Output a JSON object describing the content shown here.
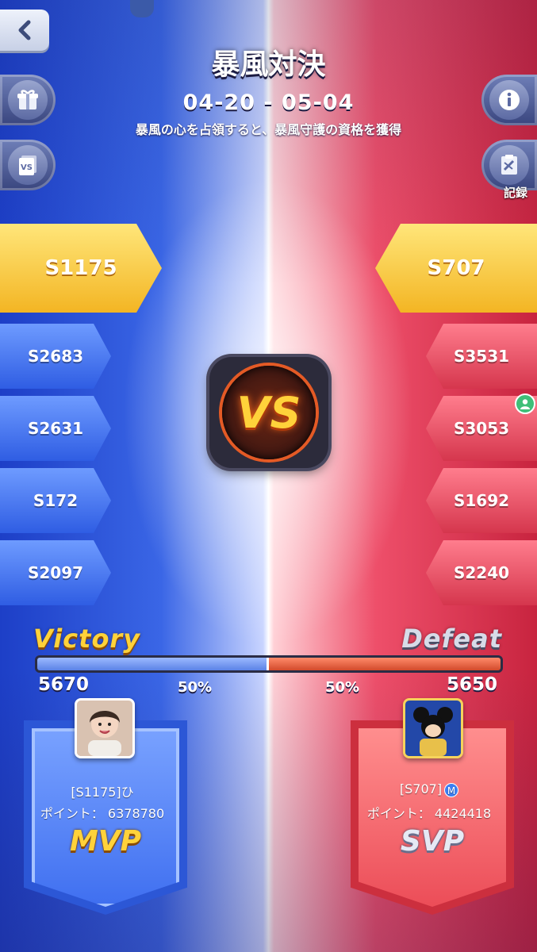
{
  "header": {
    "title": "暴風対決",
    "dates": "04-20 - 05-04",
    "subtitle": "暴風の心を占領すると、暴風守護の資格を獲得"
  },
  "buttons": {
    "record_label": "記録"
  },
  "icons": {
    "back": "back-arrow-icon",
    "gift": "gift-icon",
    "vs": "vs-icon",
    "info": "info-icon",
    "record": "record-icon",
    "profile": "profile-icon"
  },
  "left_team": {
    "main_server": "S1175",
    "servers": [
      "S2683",
      "S2631",
      "S172",
      "S2097"
    ]
  },
  "right_team": {
    "main_server": "S707",
    "servers": [
      "S3531",
      "S3053",
      "S1692",
      "S2240"
    ]
  },
  "vs_label": "VS",
  "result": {
    "left_label": "Victory",
    "right_label": "Defeat",
    "left_score": "5670",
    "right_score": "5650",
    "left_pct": "50%",
    "right_pct": "50%",
    "left_fraction": 0.5
  },
  "mvp": {
    "name": "[S1175]ひ",
    "points": "ポイント： 6378780",
    "badge": "MVP"
  },
  "svp": {
    "name": "[S707]",
    "points": "ポイント： 4424418",
    "badge": "SVP",
    "m_icon": "M"
  },
  "colors": {
    "blue_team": "#3a66e6",
    "red_team": "#ee4f6a",
    "gold": "#f3b523"
  }
}
